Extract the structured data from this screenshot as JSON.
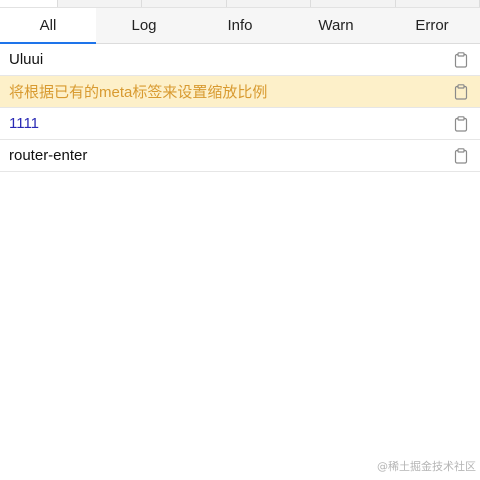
{
  "tabs": [
    {
      "label": "All",
      "active": true
    },
    {
      "label": "Log",
      "active": false
    },
    {
      "label": "Info",
      "active": false
    },
    {
      "label": "Warn",
      "active": false
    },
    {
      "label": "Error",
      "active": false
    }
  ],
  "logs": [
    {
      "text": "Uluui",
      "level": "log",
      "icon": "clipboard-icon"
    },
    {
      "text": "将根据已有的meta标签来设置缩放比例",
      "level": "warn",
      "icon": "clipboard-icon"
    },
    {
      "text": "1111",
      "level": "info",
      "icon": "clipboard-icon"
    },
    {
      "text": "router-enter",
      "level": "log",
      "icon": "clipboard-icon"
    }
  ],
  "colors": {
    "accent": "#1e74ea",
    "warn_bg": "#fdf0c9",
    "warn_text": "#d89a30",
    "info_text": "#2a2ab5"
  },
  "watermark": "@稀土掘金技术社区"
}
